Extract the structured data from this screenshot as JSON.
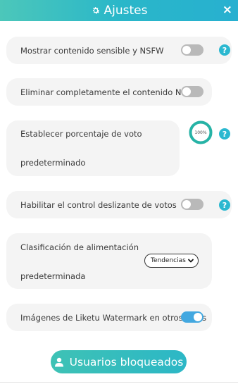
{
  "header": {
    "title": "Ajustes",
    "close_label": "×"
  },
  "settings": {
    "sensitive": {
      "label": "Mostrar contenido sensible y NSFW",
      "enabled": false
    },
    "remove_nsfw": {
      "label": "Eliminar completamente el contenido NSFW",
      "enabled": false
    },
    "vote_percentage": {
      "label_line1": "Establecer porcentaje de voto",
      "label_line2": "predeterminado",
      "value": "100%",
      "level": 1.0
    },
    "vote_slider": {
      "label": "Habilitar el control deslizante de votos",
      "enabled": false
    },
    "feed_sort": {
      "label_line1": "Clasificación de alimentación",
      "label_line2": "predeterminada",
      "selected": "Tendencias"
    },
    "watermark": {
      "label": "Imágenes de Liketu Watermark en otros sitios",
      "enabled": true
    }
  },
  "help_label": "?",
  "blocked_button": {
    "label": "Usuarios bloqueados"
  },
  "colors": {
    "accent": "#2bb8d0",
    "toggle_on": "#43a8e0",
    "toggle_off": "#b9b9b9",
    "card_bg": "#f4f4f4",
    "gauge_ring": "#26b3a6"
  },
  "icons": {
    "header": "gear-icon",
    "close": "close-icon",
    "help": "question-circle-icon",
    "select": "chevron-down-icon",
    "button": "user-icon"
  }
}
